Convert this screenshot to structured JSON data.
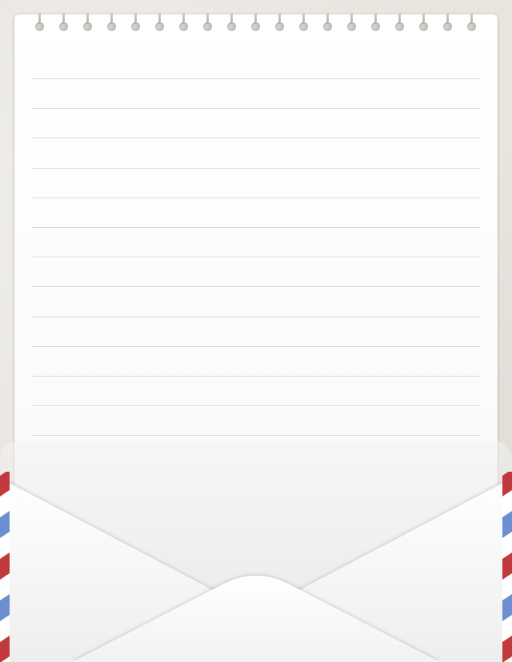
{
  "notepad": {
    "spiral_hole_count": 19,
    "ruled_line_count": 13
  },
  "envelope": {
    "stripe_colors": [
      "#c0393d",
      "#ffffff",
      "#6b8fd0"
    ]
  }
}
